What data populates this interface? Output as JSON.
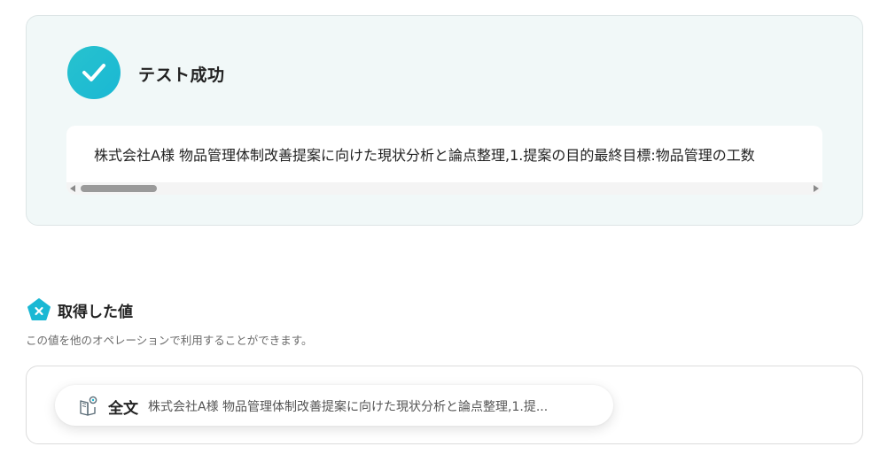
{
  "test_result": {
    "title": "テスト成功",
    "output_text": "株式会社A様 物品管理体制改善提案に向けた現状分析と論点整理,1.提案の目的最終目標:物品管理の工数",
    "scroll_position": 0.0
  },
  "retrieved_values": {
    "title": "取得した値",
    "description": "この値を他のオペレーションで利用することができます。",
    "items": [
      {
        "label": "全文",
        "value": "株式会社A様 物品管理体制改善提案に向けた現状分析と論点整理,1.提..."
      }
    ]
  },
  "colors": {
    "accent": "#1ab8d4",
    "card_bg": "#f1f8f8"
  },
  "icons": {
    "success": "check-icon",
    "section": "pentagon-x-icon",
    "value_item": "book-icon"
  }
}
